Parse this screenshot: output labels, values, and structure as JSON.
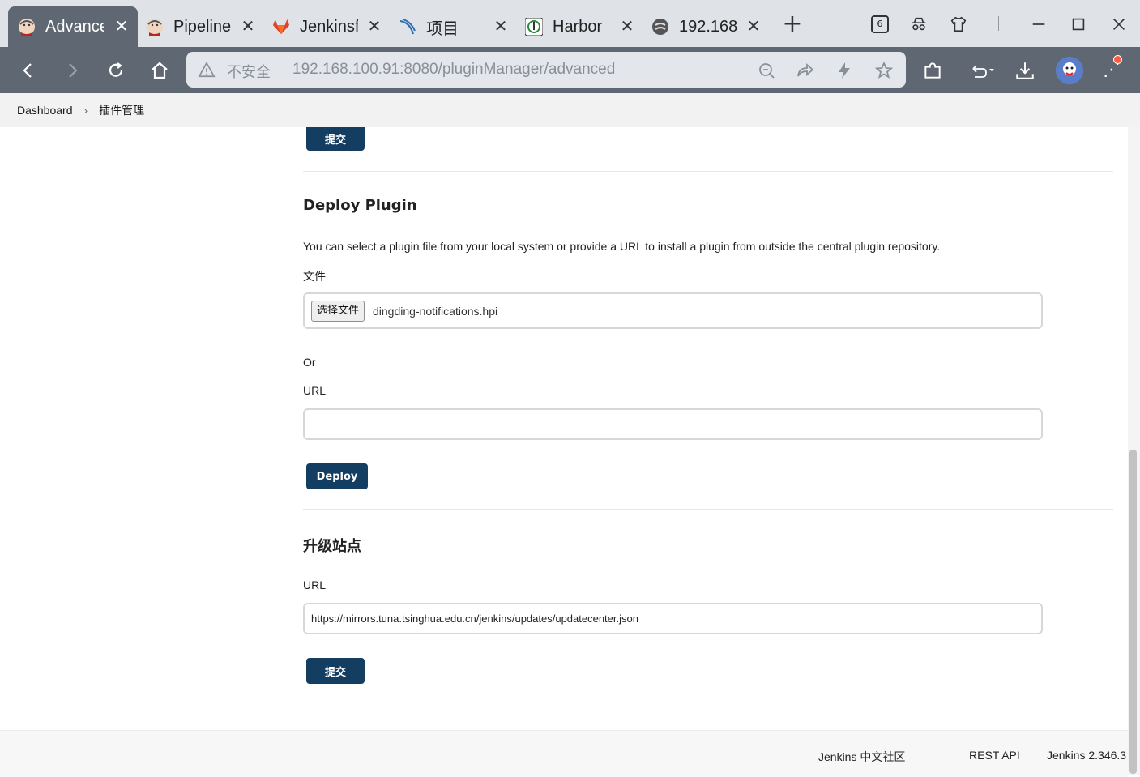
{
  "browser": {
    "tabs": [
      {
        "title": "Advance",
        "active": true,
        "icon": "jenkins-icon"
      },
      {
        "title": "Pipeline",
        "active": false,
        "icon": "jenkins-icon"
      },
      {
        "title": "Jenkinsf",
        "active": false,
        "icon": "gitlab-icon"
      },
      {
        "title": "项目",
        "active": false,
        "icon": "kubesphere-icon"
      },
      {
        "title": "Harbor",
        "active": false,
        "icon": "harbor-icon"
      },
      {
        "title": "192.168",
        "active": false,
        "icon": "rancher-icon"
      }
    ],
    "tab_count_badge": "6",
    "address_bar": {
      "security_label": "不安全",
      "url": "192.168.100.91:8080/pluginManager/advanced"
    }
  },
  "breadcrumbs": {
    "items": [
      "Dashboard",
      "插件管理"
    ]
  },
  "top_section": {
    "submit_label": "提交"
  },
  "deploy_plugin": {
    "heading": "Deploy Plugin",
    "description": "You can select a plugin file from your local system or provide a URL to install a plugin from outside the central plugin repository.",
    "file_label": "文件",
    "choose_file_label": "选择文件",
    "chosen_file": "dingding-notifications.hpi",
    "or_label": "Or",
    "url_label": "URL",
    "url_value": "",
    "deploy_label": "Deploy"
  },
  "update_site": {
    "heading": "升级站点",
    "url_label": "URL",
    "url_value": "https://mirrors.tuna.tsinghua.edu.cn/jenkins/updates/updatecenter.json",
    "submit_label": "提交"
  },
  "footer": {
    "community": "Jenkins 中文社区",
    "rest_api": "REST API",
    "version": "Jenkins 2.346.3"
  },
  "colors": {
    "primary_button": "#143e61",
    "active_tab": "#5f6872",
    "tab_strip": "#dfe3e8"
  }
}
